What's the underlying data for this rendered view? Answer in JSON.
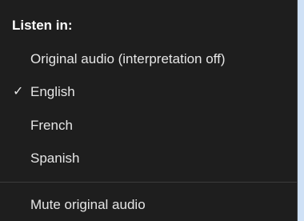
{
  "menu": {
    "header": "Listen in:",
    "items": [
      {
        "label": "Original audio (interpretation off)",
        "checked": false
      },
      {
        "label": "English",
        "checked": true
      },
      {
        "label": "French",
        "checked": false
      },
      {
        "label": "Spanish",
        "checked": false
      }
    ],
    "check_glyph": "✓",
    "mute_label": "Mute original audio"
  }
}
